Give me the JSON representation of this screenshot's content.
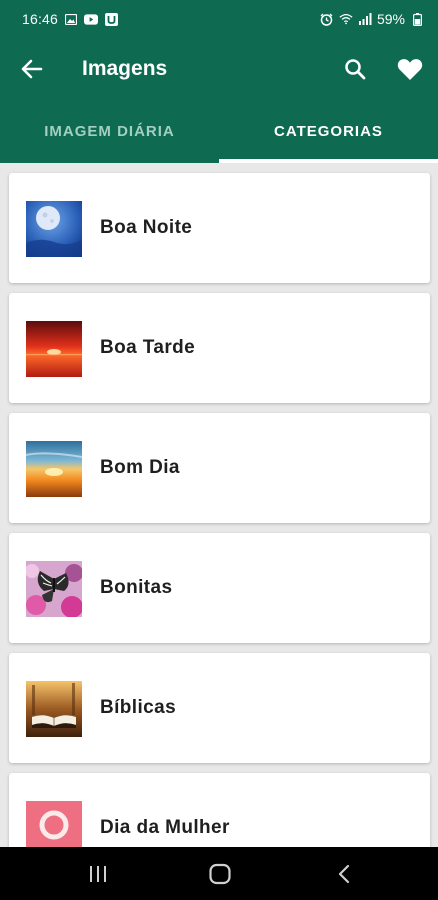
{
  "status_bar": {
    "time": "16:46",
    "battery_percent": "59%"
  },
  "app_bar": {
    "title": "Imagens"
  },
  "tabs": [
    {
      "label": "IMAGEM DIÁRIA",
      "selected": false
    },
    {
      "label": "CATEGORIAS",
      "selected": true
    }
  ],
  "categories": [
    {
      "label": "Boa Noite",
      "thumb": "moon-night-thumbnail"
    },
    {
      "label": "Boa Tarde",
      "thumb": "red-sunset-thumbnail"
    },
    {
      "label": "Bom Dia",
      "thumb": "sunrise-thumbnail"
    },
    {
      "label": "Bonitas",
      "thumb": "butterfly-flowers-thumbnail"
    },
    {
      "label": "Bíblicas",
      "thumb": "open-bible-thumbnail"
    },
    {
      "label": "Dia da Mulher",
      "thumb": "pink-ring-thumbnail"
    }
  ],
  "colors": {
    "primary": "#0e6b52",
    "tab_inactive": "#a3cfc2",
    "background": "#e8e8e8"
  }
}
